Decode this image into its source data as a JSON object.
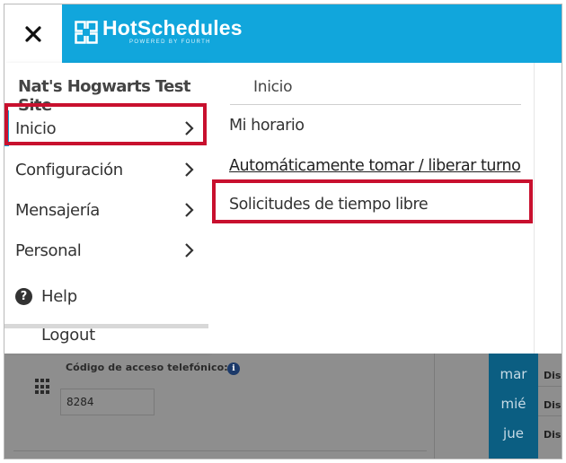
{
  "header": {
    "brand": "HotSchedules",
    "brand_sub": "POWERED BY FOURTH",
    "close_symbol": "✕",
    "brand_color": "#11a6dc"
  },
  "sidebar": {
    "site_name": "Nat's Hogwarts Test Site",
    "items": [
      {
        "label": "Inicio",
        "active": true
      },
      {
        "label": "Configuración",
        "active": false
      },
      {
        "label": "Mensajería",
        "active": false
      },
      {
        "label": "Personal",
        "active": false
      }
    ],
    "help_label": "Help",
    "logout_label": "Logout"
  },
  "submenu": {
    "title": "Inicio",
    "items": [
      {
        "label": "Mi horario"
      },
      {
        "label": "Automáticamente tomar / liberar turno"
      },
      {
        "label": "Solicitudes de tiempo libre"
      }
    ]
  },
  "background_page": {
    "code_label": "Código de acceso telefónico:",
    "code_value": "8284",
    "days": [
      "mar",
      "mié",
      "jue"
    ],
    "day_values": [
      "Dis",
      "Dis",
      "Dis"
    ]
  },
  "colors": {
    "highlight": "#c8102e",
    "accent": "#11a6dc",
    "overlay": "#8e8e8e"
  }
}
